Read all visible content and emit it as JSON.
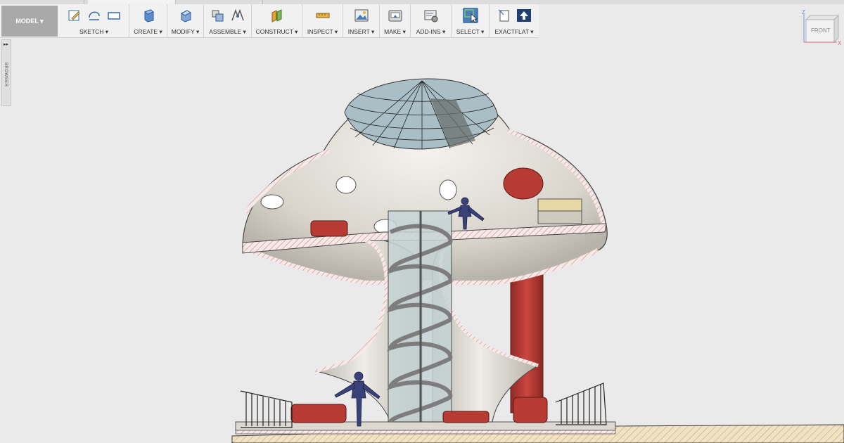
{
  "tabs": [
    "",
    "",
    ""
  ],
  "workspace": {
    "label": "MODEL ▾"
  },
  "toolbar": {
    "groups": [
      {
        "label": "SKETCH ▾"
      },
      {
        "label": "CREATE ▾"
      },
      {
        "label": "MODIFY ▾"
      },
      {
        "label": "ASSEMBLE ▾"
      },
      {
        "label": "CONSTRUCT ▾"
      },
      {
        "label": "INSPECT ▾"
      },
      {
        "label": "INSERT ▾"
      },
      {
        "label": "MAKE ▾"
      },
      {
        "label": "ADD-INS ▾"
      },
      {
        "label": "SELECT ▾"
      },
      {
        "label": "EXACTFLAT ▾"
      }
    ]
  },
  "browser": {
    "label": "BROWSER"
  },
  "viewcube": {
    "face": "FRONT",
    "axis_z": "Z",
    "axis_x": "X"
  },
  "colors": {
    "toolbar_bg": "#f1f1f1",
    "workspace_bg": "#a9a9a9",
    "select_accent": "#4d7cb7",
    "model_shell": "#e4e1da",
    "model_red": "#b73a33",
    "section_hatch": "#d9a2a2",
    "glass": "#b9cdd2",
    "ground": "#ead8b2"
  }
}
